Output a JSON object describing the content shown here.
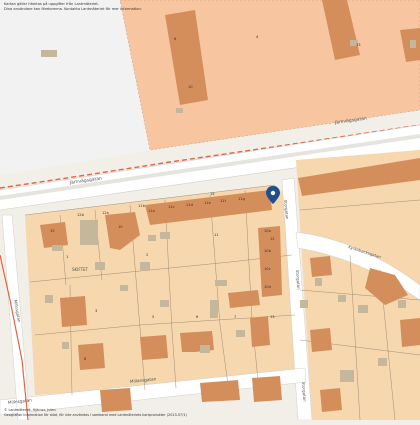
{
  "notice": {
    "line1": "Kartan gäller hämtas på uppgifter från Lantmäteriet.",
    "line2": "Dina användare kan förekomma. Kontakta Lantmäteriet för mer information."
  },
  "attribution": {
    "line1": "© Lantmäteriet, Hjärnor, Julen",
    "line2": "Geografisk information för stöd, för inte användas i samband med Lantmäteriets kartprodukter (2013-57/1)"
  },
  "streets": {
    "jarnvag_top": "Järnvägsgatan",
    "jarnvag_left": "Järnvägsgatan",
    "storgatan": "Storgatan",
    "storgatan2": "Storgatan",
    "storgatan3": "Storgatan",
    "kyrko": "Kyrkobacksgatan",
    "millans": "Millansgatan",
    "millans2": "Millansgatan",
    "lower_left": "Millnsgatan",
    "vertical_left": "Millnsgatan"
  },
  "district_label": "SKIFTET",
  "parcels": {
    "top_a": "6",
    "top_b": "4",
    "top_c": "10",
    "top_d": "33",
    "row_12b": "12b",
    "row_12a": "12a",
    "row_11b": "11b",
    "row_11a": "11a",
    "row_11c": "11c",
    "row_11d": "11d",
    "row_11e": "11e",
    "row_11f": "11f",
    "row_11g": "11g",
    "p_15": "15",
    "p_10": "10",
    "p_11": "11",
    "p_12": "12",
    "p_1": "1",
    "p_2": "2",
    "p_3": "3",
    "p_5": "5",
    "p_6": "6",
    "p_7": "7",
    "p_8": "8",
    "p_13": "13",
    "p_10a": "10a",
    "p_10b": "10b",
    "p_10c": "10c",
    "p_10d": "10d",
    "p_15b": "15"
  },
  "colors": {
    "background": "#f2efe9",
    "zone": "#f6d7ae",
    "zone_top": "#f7c6a0",
    "building": "#d48e5c",
    "outbuilding": "#c5b79b",
    "road": "#ffffff",
    "pin": "#1d4f8c",
    "rail": "#e8623f"
  },
  "pin_icon": "location-pin-icon"
}
